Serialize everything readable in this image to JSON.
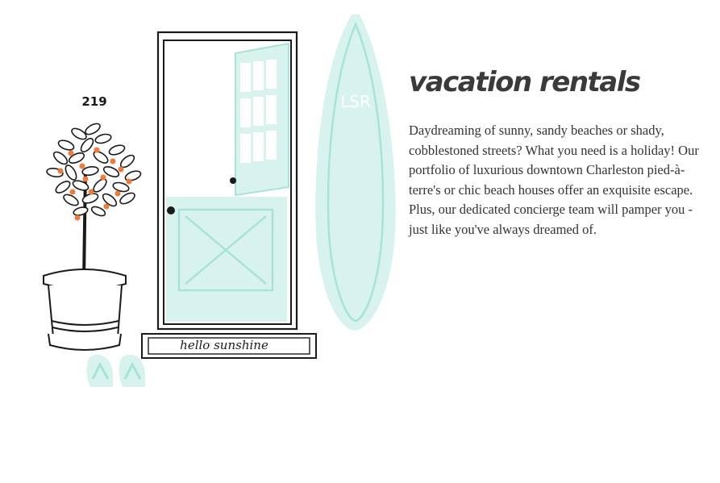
{
  "house_number": "219",
  "mat_text": "hello sunshine",
  "monogram": "LSR",
  "heading": "vacation rentals",
  "body": "Daydreaming of sunny, sandy beaches or shady, cobblestoned streets? What you need is a holiday! Our portfolio of luxurious downtown Charleston pied-à-terre's or chic beach houses offer an exquisite escape. Plus, our dedicated concierge team will pamper you - just like you've always dreamed of.",
  "colors": {
    "mint": "#d8f3ed",
    "mint_stroke": "#a8e3d8",
    "ink": "#1a1a1a",
    "orange": "#f07a3a",
    "text": "#333333"
  },
  "icons": [
    "potted-orange-tree-icon",
    "door-icon",
    "surfboard-icon",
    "doormat-icon",
    "flip-flops-icon"
  ]
}
